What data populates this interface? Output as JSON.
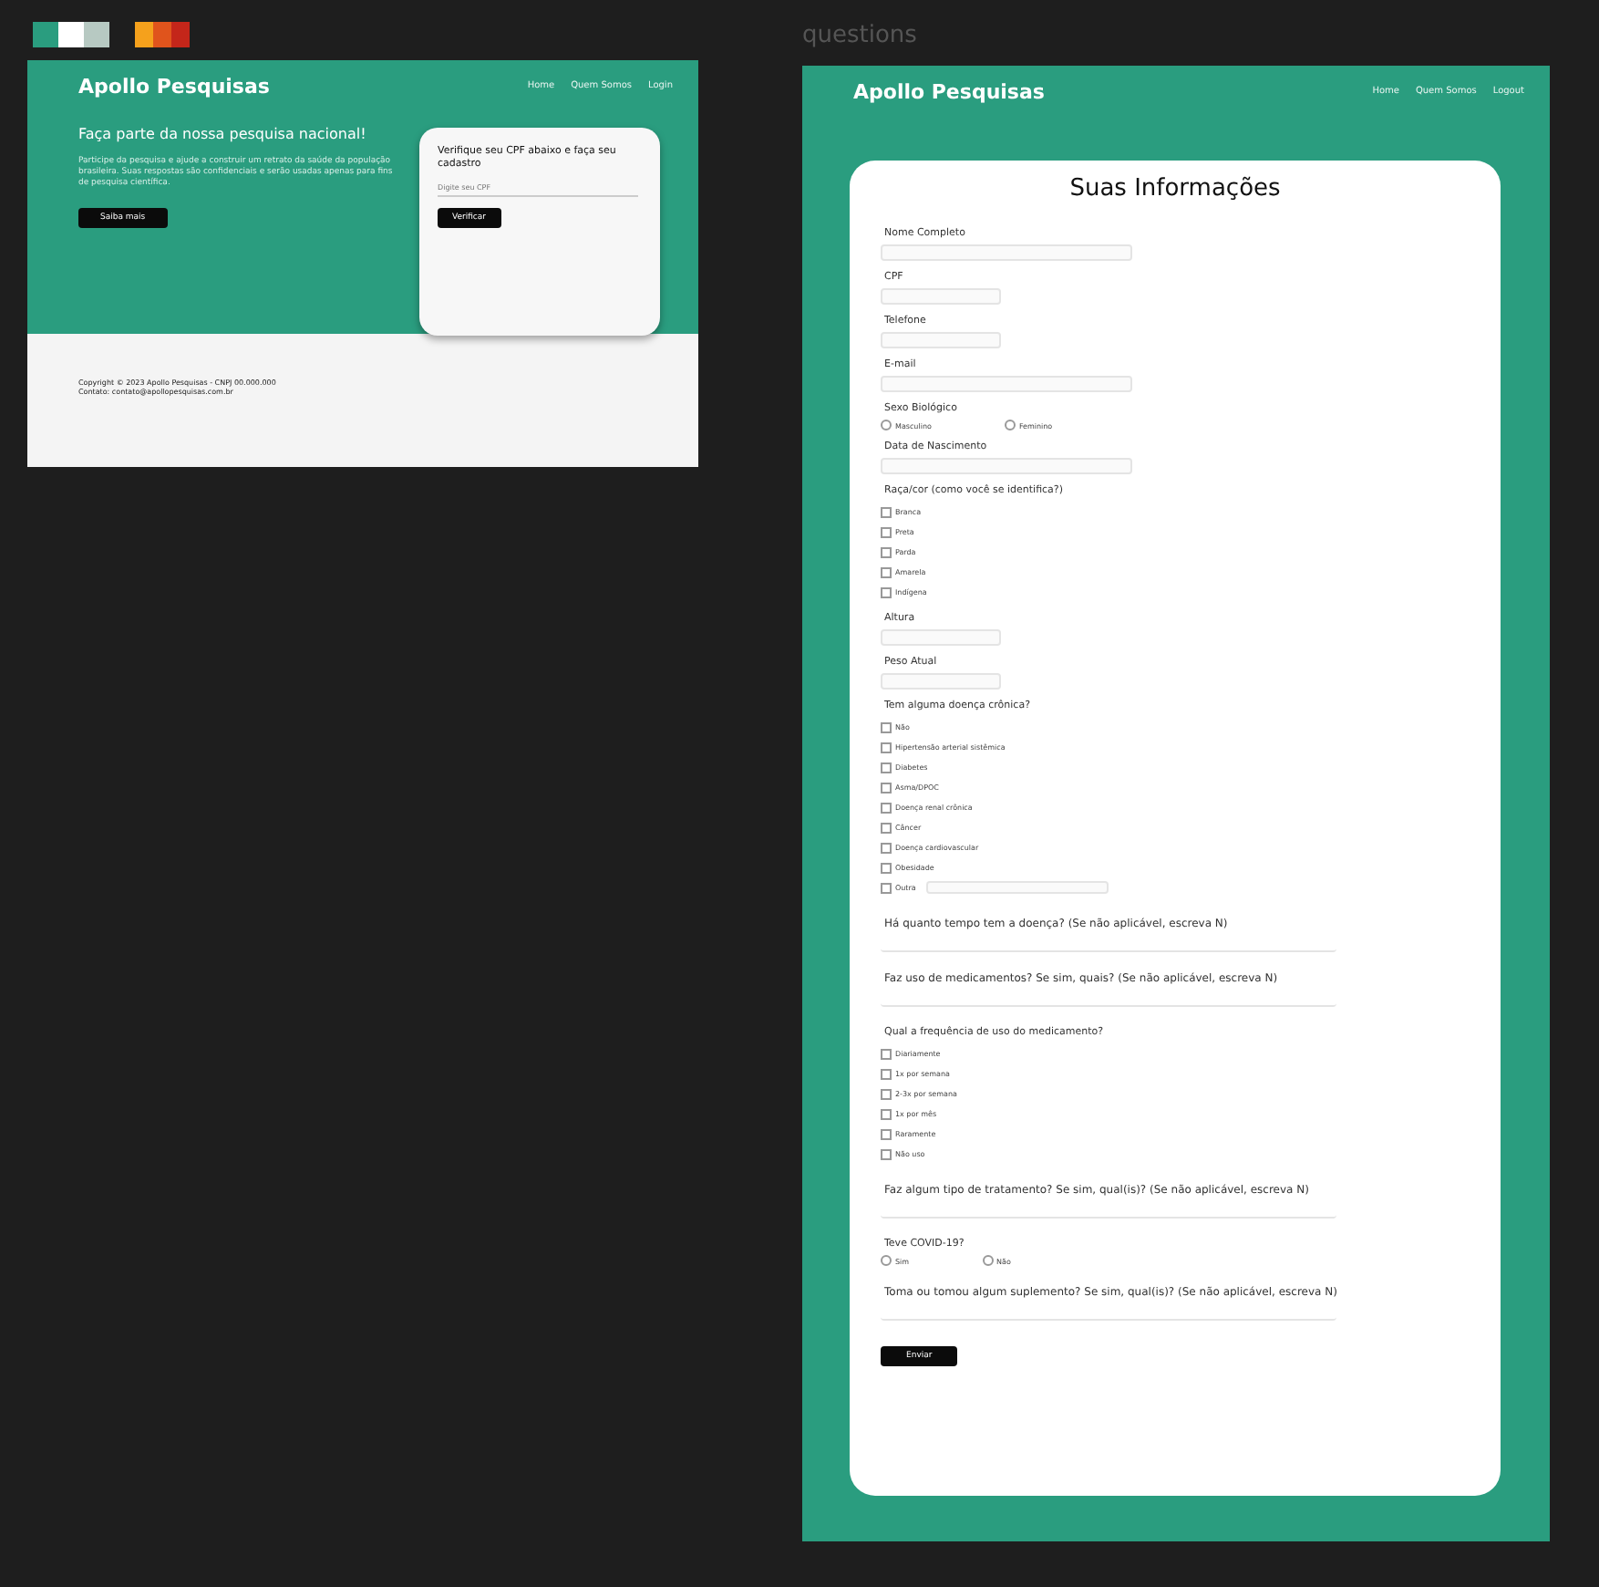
{
  "swatches": [
    {
      "chips": [
        {
          "color": "#2a9d7f"
        },
        {
          "color": "#ffffff"
        },
        {
          "color": "#b7c9c2"
        }
      ]
    },
    {
      "chips": [
        {
          "color": "#f5a11c"
        },
        {
          "color": "#e0541c"
        },
        {
          "color": "#c4261a"
        }
      ]
    }
  ],
  "home_frame": {
    "header": {
      "brand": "Apollo Pesquisas",
      "nav": [
        "Home",
        "Quem Somos",
        "Login"
      ]
    },
    "hero": {
      "title": "Faça parte da nossa pesquisa nacional!",
      "text": "Participe da pesquisa e ajude a construir um retrato da saúde da população brasileira. Suas respostas são confidenciais e serão usadas apenas para fins de pesquisa científica.",
      "button": "Saiba mais"
    },
    "cpf_card": {
      "title": "Verifique seu CPF abaixo e faça seu cadastro",
      "placeholder": "Digite seu CPF",
      "button": "Verificar"
    },
    "footer": [
      "Copyright © 2023 Apollo Pesquisas - CNPJ 00.000.000",
      "Contato: contato@apollopesquisas.com.br"
    ]
  },
  "questions_frame": {
    "label": "questions",
    "header": {
      "brand": "Apollo Pesquisas",
      "nav": [
        "Home",
        "Quem Somos",
        "Logout"
      ]
    },
    "form": {
      "title": "Suas Informações",
      "items": [
        {
          "kind": "long",
          "label": "Nome Completo"
        },
        {
          "kind": "short",
          "label": "CPF"
        },
        {
          "kind": "short",
          "label": "Telefone"
        },
        {
          "kind": "long",
          "label": "E-mail"
        },
        {
          "kind": "radio",
          "label": "Sexo Biológico",
          "options": [
            {
              "label": "Masculino",
              "selected": false
            },
            {
              "label": "Feminino",
              "selected": false
            }
          ]
        },
        {
          "kind": "long",
          "label": "Data de Nascimento"
        },
        {
          "kind": "checkbox",
          "label": "Raça/cor (como você se identifica?)",
          "options": [
            {
              "label": "Branca",
              "checked": false
            },
            {
              "label": "Preta",
              "checked": false
            },
            {
              "label": "Parda",
              "checked": false
            },
            {
              "label": "Amarela",
              "checked": false
            },
            {
              "label": "Indígena",
              "checked": false
            }
          ]
        },
        {
          "kind": "short",
          "label": "Altura"
        },
        {
          "kind": "short",
          "label": "Peso Atual"
        },
        {
          "kind": "checkbox",
          "label": "Tem alguma doença crônica?",
          "options": [
            {
              "kind": "plain",
              "label": "Não",
              "checked": false
            },
            {
              "kind": "plain",
              "label": "Hipertensão arterial sistêmica",
              "checked": false
            },
            {
              "kind": "plain",
              "label": "Diabetes",
              "checked": false
            },
            {
              "kind": "plain",
              "label": "Asma/DPOC",
              "checked": false
            },
            {
              "kind": "plain",
              "label": "Doença renal crônica",
              "checked": false
            },
            {
              "kind": "plain",
              "label": "Câncer",
              "checked": false
            },
            {
              "kind": "plain",
              "label": "Doença cardiovascular",
              "checked": false
            },
            {
              "kind": "plain",
              "label": "Obesidade",
              "checked": false
            },
            {
              "kind": "field",
              "label": "Outra",
              "checked": false
            }
          ]
        },
        {
          "kind": "wide",
          "label": "Há quanto tempo tem a doença? (Se não aplicável, escreva N)"
        },
        {
          "kind": "wide",
          "label": "Faz uso de medicamentos? Se sim, quais? (Se não aplicável, escreva N)"
        },
        {
          "kind": "checkbox",
          "label": "Qual a frequência de uso do medicamento?",
          "options": [
            {
              "label": "Diariamente",
              "checked": false
            },
            {
              "label": "1x por semana",
              "checked": false
            },
            {
              "label": "2-3x por semana",
              "checked": false
            },
            {
              "label": "1x por mês",
              "checked": false
            },
            {
              "label": "Raramente",
              "checked": false
            },
            {
              "label": "Não uso",
              "checked": false
            }
          ]
        },
        {
          "kind": "wide",
          "label": "Faz algum tipo de tratamento? Se sim, qual(is)? (Se não aplicável, escreva N)"
        },
        {
          "kind": "radio",
          "label": "Teve COVID-19?",
          "options": [
            {
              "label": "Sim",
              "selected": false
            },
            {
              "label": "Não",
              "selected": false
            }
          ]
        },
        {
          "kind": "wide",
          "label": "Toma ou tomou algum suplemento? Se sim, qual(is)? (Se não aplicável, escreva N)"
        }
      ],
      "submit": "Enviar"
    }
  }
}
